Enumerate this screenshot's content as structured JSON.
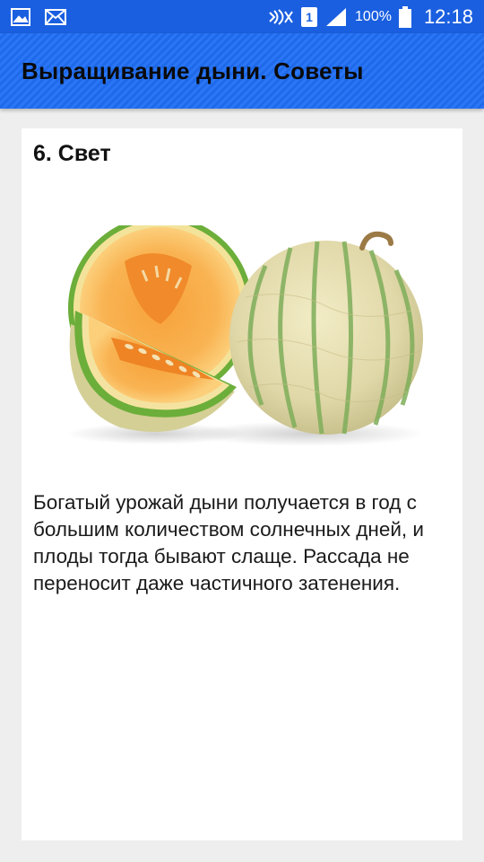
{
  "status_bar": {
    "icons_left": [
      "image-icon",
      "mail-icon"
    ],
    "sim": "1",
    "battery": "100%",
    "time": "12:18"
  },
  "app_bar": {
    "title": "Выращивание дыни. Советы"
  },
  "article": {
    "heading": "6. Свет",
    "image_subject": "melon-image",
    "body": "Богатый урожай дыни получается в год с большим количеством солнечных дней, и плоды тогда бывают слаще. Рассада не переносит даже частичного затенения."
  }
}
